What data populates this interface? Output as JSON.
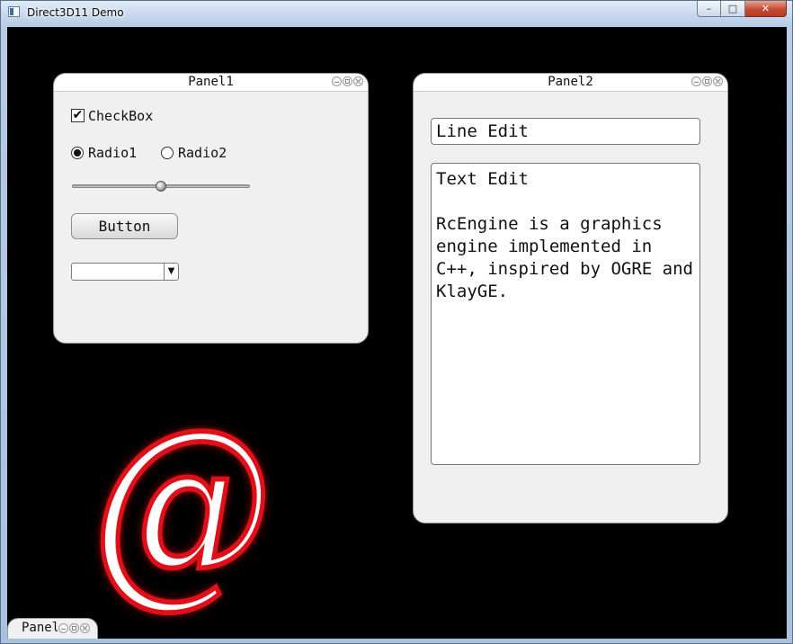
{
  "window": {
    "title": "Direct3D11 Demo",
    "controls": {
      "minimize": "–",
      "maximize": "□",
      "close": "✕"
    }
  },
  "panel1": {
    "title": "Panel1",
    "checkbox": {
      "label": "CheckBox",
      "checked": true,
      "mark": "✔"
    },
    "radios": [
      {
        "label": "Radio1",
        "selected": true
      },
      {
        "label": "Radio2",
        "selected": false
      }
    ],
    "slider": {
      "value": 0.5
    },
    "button_label": "Button",
    "combo": {
      "selected": "",
      "arrow": "▼"
    }
  },
  "panel2": {
    "title": "Panel2",
    "line_edit": "Line Edit",
    "text_edit": {
      "first_line": "Text Edit",
      "body": "RcEngine is a graphics engine implemented in C++, inspired by OGRE and KlayGE."
    }
  },
  "panel3": {
    "title": "Panel3"
  },
  "scene": {
    "glyph": "@",
    "glyph_color": "#e0101a"
  },
  "icons": [
    "app-icon",
    "minimize-icon",
    "maximize-icon",
    "close-icon",
    "checkmark-icon",
    "chevron-down-icon"
  ]
}
